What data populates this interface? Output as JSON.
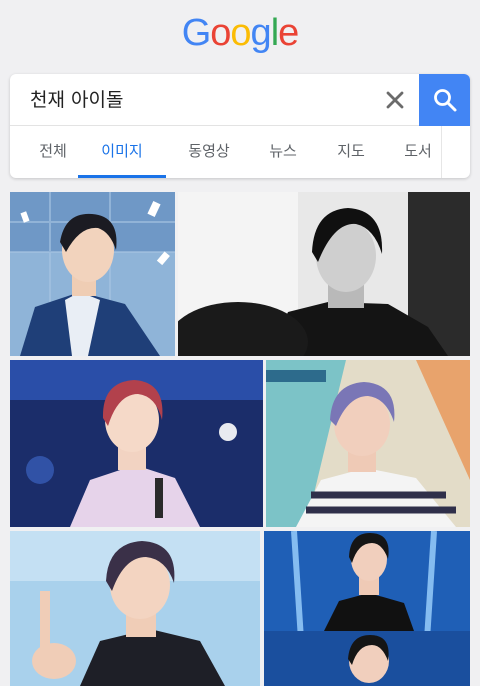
{
  "logo": {
    "letters": [
      {
        "char": "G",
        "color": "#4285f4"
      },
      {
        "char": "o",
        "color": "#ea4335"
      },
      {
        "char": "o",
        "color": "#fbbc05"
      },
      {
        "char": "g",
        "color": "#4285f4"
      },
      {
        "char": "l",
        "color": "#34a853"
      },
      {
        "char": "e",
        "color": "#ea4335"
      }
    ]
  },
  "search": {
    "query": "천재 아이돌",
    "clear_icon": "close-icon",
    "search_icon": "search-icon",
    "accent": "#4285f4"
  },
  "tabs": [
    {
      "label": "전체",
      "active": false
    },
    {
      "label": "이미지",
      "active": true
    },
    {
      "label": "동영상",
      "active": false
    },
    {
      "label": "뉴스",
      "active": false
    },
    {
      "label": "지도",
      "active": false
    },
    {
      "label": "도서",
      "active": false
    }
  ],
  "results": {
    "images": [
      {
        "kind": "photo",
        "palette": "blue-stage"
      },
      {
        "kind": "photo",
        "palette": "black-white"
      },
      {
        "kind": "photo",
        "palette": "navy-concert"
      },
      {
        "kind": "photo",
        "palette": "pastel-stage"
      },
      {
        "kind": "photo",
        "palette": "sky-blue"
      },
      {
        "kind": "photo",
        "palette": "blue-lights"
      }
    ]
  }
}
